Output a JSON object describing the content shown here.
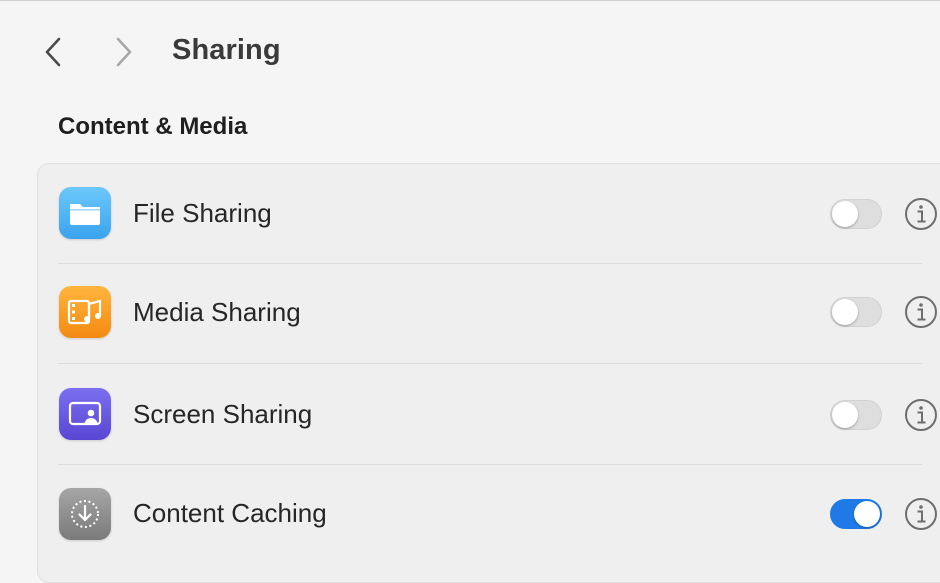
{
  "toolbar": {
    "title": "Sharing"
  },
  "section": {
    "heading": "Content & Media"
  },
  "rows": [
    {
      "label": "File Sharing",
      "icon": "folder-icon",
      "enabled": false,
      "accent": "#4fb3f5"
    },
    {
      "label": "Media Sharing",
      "icon": "film-music-icon",
      "enabled": false,
      "accent": "#f7a323"
    },
    {
      "label": "Screen Sharing",
      "icon": "screen-share-icon",
      "enabled": false,
      "accent": "#6a5ce0"
    },
    {
      "label": "Content Caching",
      "icon": "download-circle-icon",
      "enabled": true,
      "accent": "#8c8c8c"
    }
  ],
  "colors": {
    "toggle_on": "#1f7ae7",
    "toggle_off": "#dedede"
  }
}
